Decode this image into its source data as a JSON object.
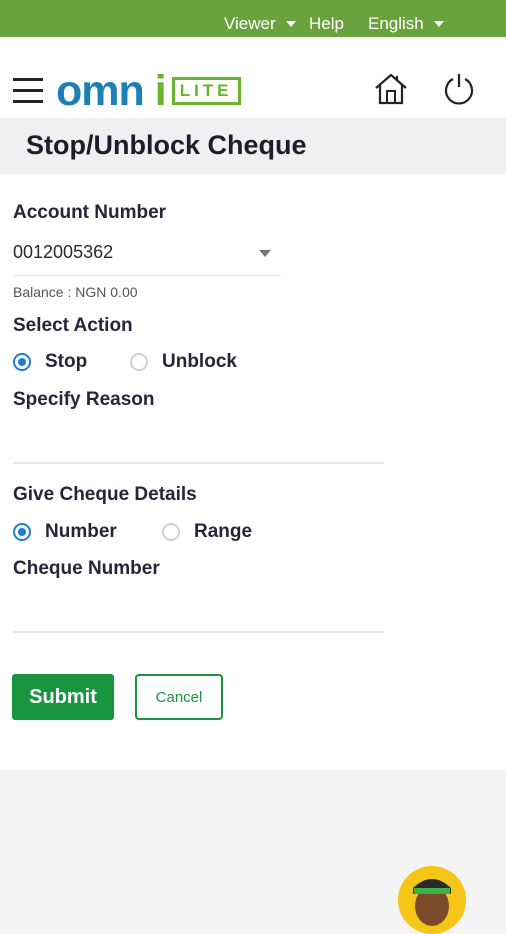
{
  "topbar": {
    "viewer_label": "Viewer",
    "help_label": "Help",
    "language_label": "English",
    "bg_color": "#6aa23e"
  },
  "header": {
    "logo_text": "omni",
    "logo_badge": "LITE",
    "icons": [
      "menu-icon",
      "home-icon",
      "power-icon"
    ]
  },
  "page": {
    "title": "Stop/Unblock Cheque"
  },
  "form": {
    "account_label": "Account Number",
    "account_value": "0012005362",
    "balance_text": "Balance : NGN 0.00",
    "action_label": "Select Action",
    "action_options": [
      {
        "label": "Stop",
        "selected": true
      },
      {
        "label": "Unblock",
        "selected": false
      }
    ],
    "reason_label": "Specify Reason",
    "reason_value": "",
    "cheque_details_label": "Give Cheque Details",
    "detail_options": [
      {
        "label": "Number",
        "selected": true
      },
      {
        "label": "Range",
        "selected": false
      }
    ],
    "cheque_number_label": "Cheque Number",
    "cheque_number_value": ""
  },
  "actions": {
    "submit_label": "Submit",
    "cancel_label": "Cancel"
  },
  "colors": {
    "accent_green": "#17963f",
    "radio_blue": "#1e7fd0",
    "logo_blue": "#1e7fb5",
    "logo_green": "#69b32f"
  }
}
